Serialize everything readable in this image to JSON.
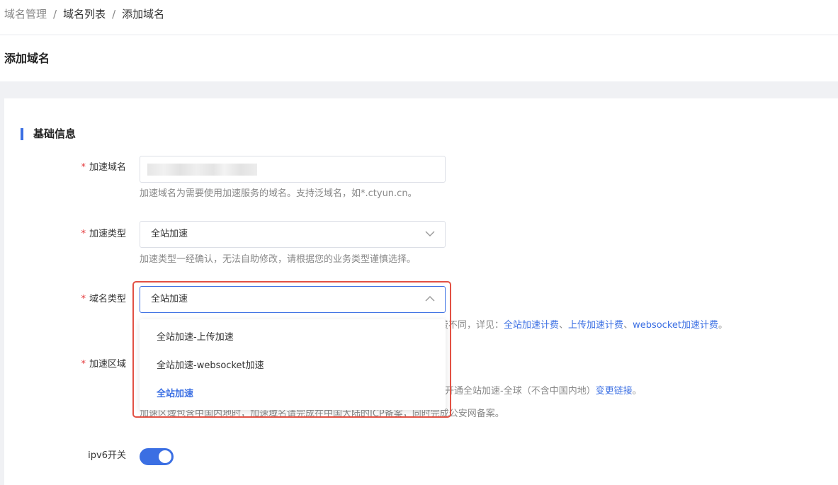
{
  "breadcrumb": {
    "items": [
      "域名管理",
      "域名列表",
      "添加域名"
    ],
    "separator": "/"
  },
  "page_title": "添加域名",
  "section": {
    "title": "基础信息"
  },
  "form": {
    "required_mark": "*",
    "domain": {
      "label": "加速域名",
      "value": "",
      "hint": "加速域名为需要使用加速服务的域名。支持泛域名，如*.ctyun.cn。"
    },
    "accel_type": {
      "label": "加速类型",
      "value": "全站加速",
      "hint": "加速类型一经确认，无法自助修改，请根据您的业务类型谨慎选择。"
    },
    "domain_type": {
      "label": "域名类型",
      "value": "全站加速",
      "hint_visible": "费不同，详见：",
      "hint_links": [
        "全站加速计费",
        "上传加速计费",
        "websocket加速计费"
      ],
      "hint_sep": "、",
      "hint_end": "。",
      "options": [
        {
          "label": "全站加速-上传加速",
          "selected": false
        },
        {
          "label": "全站加速-websocket加速",
          "selected": false
        },
        {
          "label": "全站加速",
          "selected": true
        }
      ]
    },
    "region": {
      "label": "加速区域",
      "hint1_visible": "开通全站加速-全球（不含中国内地）",
      "hint1_link": "变更链接",
      "hint1_end": "。",
      "hint2_visible": "加速区域包含中国内地时，加速域名请完成在中国大陆的ICP备案，同时完成公安网备案。"
    },
    "ipv6": {
      "label": "ipv6开关",
      "enabled": true
    }
  },
  "colors": {
    "accent": "#3b6fe3",
    "required": "#e4393c",
    "highlight_frame": "#e25144"
  },
  "icons": {
    "accel_type_chevron": "chevron-down-icon",
    "domain_type_chevron": "chevron-up-icon"
  }
}
